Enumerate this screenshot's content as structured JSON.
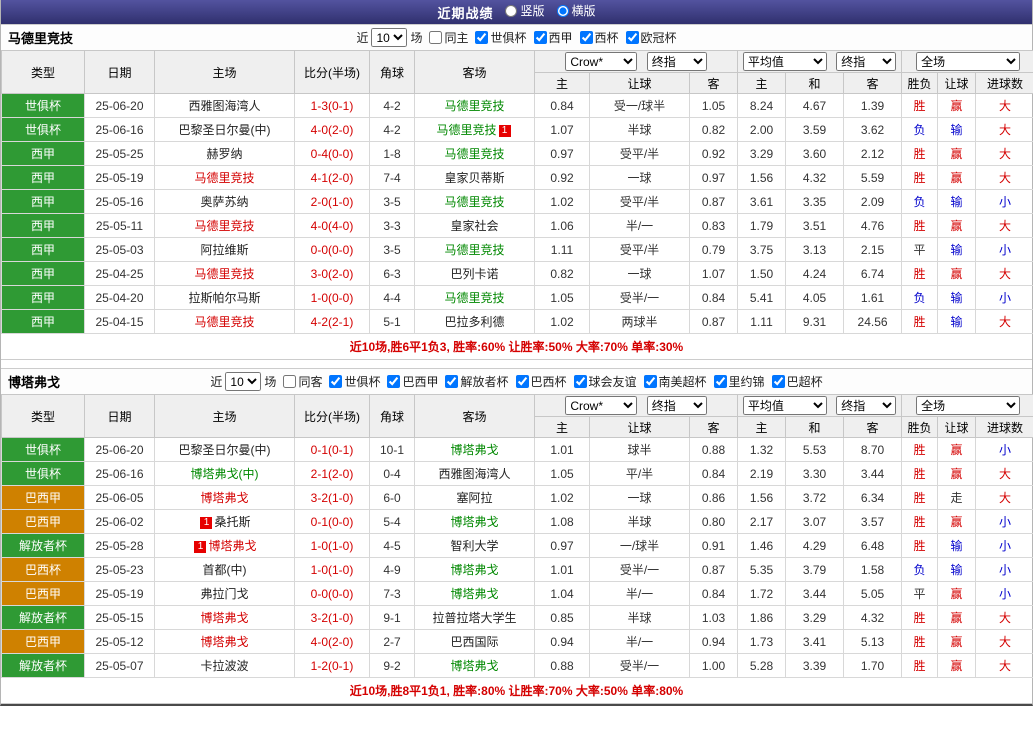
{
  "topbar": {
    "title": "近期战绩",
    "options": [
      {
        "label": "竖版",
        "selected": false
      },
      {
        "label": "横版",
        "selected": true
      }
    ]
  },
  "columns": {
    "type": "类型",
    "date": "日期",
    "home": "主场",
    "score": "比分(半场)",
    "corner": "角球",
    "away": "客场",
    "h_home": "主",
    "h_handicap": "让球",
    "h_away": "客",
    "a_home": "主",
    "a_draw": "和",
    "a_away": "客",
    "result": "胜负",
    "handicap_result": "让球",
    "goals": "进球数"
  },
  "selects": {
    "book": "Crow*",
    "final1": "终指",
    "avg": "平均值",
    "final2": "终指",
    "scope": "全场"
  },
  "tables": [
    {
      "team": "马德里竞技",
      "filter": {
        "near": "近",
        "count": "10",
        "unit": "场",
        "same": "同主",
        "same_checked": false,
        "leagues": [
          {
            "label": "世俱杯",
            "checked": true
          },
          {
            "label": "西甲",
            "checked": true
          },
          {
            "label": "西杯",
            "checked": true
          },
          {
            "label": "欧冠杯",
            "checked": true
          }
        ]
      },
      "rows": [
        {
          "league": "世俱杯",
          "league_cls": "lg-green",
          "date": "25-06-20",
          "home": "西雅图海湾人",
          "home_cls": "black",
          "home_badge": "",
          "score": "1-3(0-1)",
          "corner": "4-2",
          "away": "马德里竞技",
          "away_cls": "green",
          "away_badge": "",
          "odds": [
            "0.84",
            "受一/球半",
            "1.05"
          ],
          "avg": [
            "8.24",
            "4.67",
            "1.39"
          ],
          "res": [
            {
              "t": "胜",
              "c": "red"
            },
            {
              "t": "赢",
              "c": "red"
            },
            {
              "t": "大",
              "c": "red"
            }
          ]
        },
        {
          "league": "世俱杯",
          "league_cls": "lg-green",
          "date": "25-06-16",
          "home": "巴黎圣日尔曼(中)",
          "home_cls": "black",
          "home_badge": "",
          "score": "4-0(2-0)",
          "corner": "4-2",
          "away": "马德里竞技",
          "away_cls": "green",
          "away_badge": "1",
          "odds": [
            "1.07",
            "半球",
            "0.82"
          ],
          "avg": [
            "2.00",
            "3.59",
            "3.62"
          ],
          "res": [
            {
              "t": "负",
              "c": "blue"
            },
            {
              "t": "输",
              "c": "blue"
            },
            {
              "t": "大",
              "c": "red"
            }
          ]
        },
        {
          "league": "西甲",
          "league_cls": "lg-green",
          "date": "25-05-25",
          "home": "赫罗纳",
          "home_cls": "black",
          "home_badge": "",
          "score": "0-4(0-0)",
          "corner": "1-8",
          "away": "马德里竞技",
          "away_cls": "green",
          "away_badge": "",
          "odds": [
            "0.97",
            "受平/半",
            "0.92"
          ],
          "avg": [
            "3.29",
            "3.60",
            "2.12"
          ],
          "res": [
            {
              "t": "胜",
              "c": "red"
            },
            {
              "t": "赢",
              "c": "red"
            },
            {
              "t": "大",
              "c": "red"
            }
          ]
        },
        {
          "league": "西甲",
          "league_cls": "lg-green",
          "date": "25-05-19",
          "home": "马德里竞技",
          "home_cls": "red",
          "home_badge": "",
          "score": "4-1(2-0)",
          "corner": "7-4",
          "away": "皇家贝蒂斯",
          "away_cls": "black",
          "away_badge": "",
          "odds": [
            "0.92",
            "一球",
            "0.97"
          ],
          "avg": [
            "1.56",
            "4.32",
            "5.59"
          ],
          "res": [
            {
              "t": "胜",
              "c": "red"
            },
            {
              "t": "赢",
              "c": "red"
            },
            {
              "t": "大",
              "c": "red"
            }
          ]
        },
        {
          "league": "西甲",
          "league_cls": "lg-green",
          "date": "25-05-16",
          "home": "奥萨苏纳",
          "home_cls": "black",
          "home_badge": "",
          "score": "2-0(1-0)",
          "corner": "3-5",
          "away": "马德里竞技",
          "away_cls": "green",
          "away_badge": "",
          "odds": [
            "1.02",
            "受平/半",
            "0.87"
          ],
          "avg": [
            "3.61",
            "3.35",
            "2.09"
          ],
          "res": [
            {
              "t": "负",
              "c": "blue"
            },
            {
              "t": "输",
              "c": "blue"
            },
            {
              "t": "小",
              "c": "blue"
            }
          ]
        },
        {
          "league": "西甲",
          "league_cls": "lg-green",
          "date": "25-05-11",
          "home": "马德里竞技",
          "home_cls": "red",
          "home_badge": "",
          "score": "4-0(4-0)",
          "corner": "3-3",
          "away": "皇家社会",
          "away_cls": "black",
          "away_badge": "",
          "odds": [
            "1.06",
            "半/一",
            "0.83"
          ],
          "avg": [
            "1.79",
            "3.51",
            "4.76"
          ],
          "res": [
            {
              "t": "胜",
              "c": "red"
            },
            {
              "t": "赢",
              "c": "red"
            },
            {
              "t": "大",
              "c": "red"
            }
          ]
        },
        {
          "league": "西甲",
          "league_cls": "lg-green",
          "date": "25-05-03",
          "home": "阿拉维斯",
          "home_cls": "black",
          "home_badge": "",
          "score": "0-0(0-0)",
          "corner": "3-5",
          "away": "马德里竞技",
          "away_cls": "green",
          "away_badge": "",
          "odds": [
            "1.11",
            "受平/半",
            "0.79"
          ],
          "avg": [
            "3.75",
            "3.13",
            "2.15"
          ],
          "res": [
            {
              "t": "平",
              "c": "black"
            },
            {
              "t": "输",
              "c": "blue"
            },
            {
              "t": "小",
              "c": "blue"
            }
          ]
        },
        {
          "league": "西甲",
          "league_cls": "lg-green",
          "date": "25-04-25",
          "home": "马德里竞技",
          "home_cls": "red",
          "home_badge": "",
          "score": "3-0(2-0)",
          "corner": "6-3",
          "away": "巴列卡诺",
          "away_cls": "black",
          "away_badge": "",
          "odds": [
            "0.82",
            "一球",
            "1.07"
          ],
          "avg": [
            "1.50",
            "4.24",
            "6.74"
          ],
          "res": [
            {
              "t": "胜",
              "c": "red"
            },
            {
              "t": "赢",
              "c": "red"
            },
            {
              "t": "大",
              "c": "red"
            }
          ]
        },
        {
          "league": "西甲",
          "league_cls": "lg-green",
          "date": "25-04-20",
          "home": "拉斯帕尔马斯",
          "home_cls": "black",
          "home_badge": "",
          "score": "1-0(0-0)",
          "corner": "4-4",
          "away": "马德里竞技",
          "away_cls": "green",
          "away_badge": "",
          "odds": [
            "1.05",
            "受半/一",
            "0.84"
          ],
          "avg": [
            "5.41",
            "4.05",
            "1.61"
          ],
          "res": [
            {
              "t": "负",
              "c": "blue"
            },
            {
              "t": "输",
              "c": "blue"
            },
            {
              "t": "小",
              "c": "blue"
            }
          ]
        },
        {
          "league": "西甲",
          "league_cls": "lg-green",
          "date": "25-04-15",
          "home": "马德里竞技",
          "home_cls": "red",
          "home_badge": "",
          "score": "4-2(2-1)",
          "corner": "5-1",
          "away": "巴拉多利德",
          "away_cls": "black",
          "away_badge": "",
          "odds": [
            "1.02",
            "两球半",
            "0.87"
          ],
          "avg": [
            "1.11",
            "9.31",
            "24.56"
          ],
          "res": [
            {
              "t": "胜",
              "c": "red"
            },
            {
              "t": "输",
              "c": "blue"
            },
            {
              "t": "大",
              "c": "red"
            }
          ]
        }
      ],
      "summary": "近10场,胜6平1负3, 胜率:60% 让胜率:50% 大率:70% 单率:30%"
    },
    {
      "team": "博塔弗戈",
      "filter": {
        "near": "近",
        "count": "10",
        "unit": "场",
        "same": "同客",
        "same_checked": false,
        "leagues": [
          {
            "label": "世俱杯",
            "checked": true
          },
          {
            "label": "巴西甲",
            "checked": true
          },
          {
            "label": "解放者杯",
            "checked": true
          },
          {
            "label": "巴西杯",
            "checked": true
          },
          {
            "label": "球会友谊",
            "checked": true
          },
          {
            "label": "南美超杯",
            "checked": true
          },
          {
            "label": "里约锦",
            "checked": true
          },
          {
            "label": "巴超杯",
            "checked": true
          }
        ]
      },
      "rows": [
        {
          "league": "世俱杯",
          "league_cls": "lg-green",
          "date": "25-06-20",
          "home": "巴黎圣日尔曼(中)",
          "home_cls": "black",
          "home_badge": "",
          "score": "0-1(0-1)",
          "corner": "10-1",
          "away": "博塔弗戈",
          "away_cls": "green",
          "away_badge": "",
          "odds": [
            "1.01",
            "球半",
            "0.88"
          ],
          "avg": [
            "1.32",
            "5.53",
            "8.70"
          ],
          "res": [
            {
              "t": "胜",
              "c": "red"
            },
            {
              "t": "赢",
              "c": "red"
            },
            {
              "t": "小",
              "c": "blue"
            }
          ]
        },
        {
          "league": "世俱杯",
          "league_cls": "lg-green",
          "date": "25-06-16",
          "home": "博塔弗戈(中)",
          "home_cls": "green",
          "home_badge": "",
          "score": "2-1(2-0)",
          "corner": "0-4",
          "away": "西雅图海湾人",
          "away_cls": "black",
          "away_badge": "",
          "odds": [
            "1.05",
            "平/半",
            "0.84"
          ],
          "avg": [
            "2.19",
            "3.30",
            "3.44"
          ],
          "res": [
            {
              "t": "胜",
              "c": "red"
            },
            {
              "t": "赢",
              "c": "red"
            },
            {
              "t": "大",
              "c": "red"
            }
          ]
        },
        {
          "league": "巴西甲",
          "league_cls": "lg-orange",
          "date": "25-06-05",
          "home": "博塔弗戈",
          "home_cls": "red",
          "home_badge": "",
          "score": "3-2(1-0)",
          "corner": "6-0",
          "away": "塞阿拉",
          "away_cls": "black",
          "away_badge": "",
          "odds": [
            "1.02",
            "一球",
            "0.86"
          ],
          "avg": [
            "1.56",
            "3.72",
            "6.34"
          ],
          "res": [
            {
              "t": "胜",
              "c": "red"
            },
            {
              "t": "走",
              "c": "black"
            },
            {
              "t": "大",
              "c": "red"
            }
          ]
        },
        {
          "league": "巴西甲",
          "league_cls": "lg-orange",
          "date": "25-06-02",
          "home": "桑托斯",
          "home_cls": "black",
          "home_badge": "1",
          "score": "0-1(0-0)",
          "corner": "5-4",
          "away": "博塔弗戈",
          "away_cls": "green",
          "away_badge": "",
          "odds": [
            "1.08",
            "半球",
            "0.80"
          ],
          "avg": [
            "2.17",
            "3.07",
            "3.57"
          ],
          "res": [
            {
              "t": "胜",
              "c": "red"
            },
            {
              "t": "赢",
              "c": "red"
            },
            {
              "t": "小",
              "c": "blue"
            }
          ]
        },
        {
          "league": "解放者杯",
          "league_cls": "lg-green",
          "date": "25-05-28",
          "home": "博塔弗戈",
          "home_cls": "red",
          "home_badge": "1",
          "score": "1-0(1-0)",
          "corner": "4-5",
          "away": "智利大学",
          "away_cls": "black",
          "away_badge": "",
          "odds": [
            "0.97",
            "一/球半",
            "0.91"
          ],
          "avg": [
            "1.46",
            "4.29",
            "6.48"
          ],
          "res": [
            {
              "t": "胜",
              "c": "red"
            },
            {
              "t": "输",
              "c": "blue"
            },
            {
              "t": "小",
              "c": "blue"
            }
          ]
        },
        {
          "league": "巴西杯",
          "league_cls": "lg-orange",
          "date": "25-05-23",
          "home": "首都(中)",
          "home_cls": "black",
          "home_badge": "",
          "score": "1-0(1-0)",
          "corner": "4-9",
          "away": "博塔弗戈",
          "away_cls": "green",
          "away_badge": "",
          "odds": [
            "1.01",
            "受半/一",
            "0.87"
          ],
          "avg": [
            "5.35",
            "3.79",
            "1.58"
          ],
          "res": [
            {
              "t": "负",
              "c": "blue"
            },
            {
              "t": "输",
              "c": "blue"
            },
            {
              "t": "小",
              "c": "blue"
            }
          ]
        },
        {
          "league": "巴西甲",
          "league_cls": "lg-orange",
          "date": "25-05-19",
          "home": "弗拉门戈",
          "home_cls": "black",
          "home_badge": "",
          "score": "0-0(0-0)",
          "corner": "7-3",
          "away": "博塔弗戈",
          "away_cls": "green",
          "away_badge": "",
          "odds": [
            "1.04",
            "半/一",
            "0.84"
          ],
          "avg": [
            "1.72",
            "3.44",
            "5.05"
          ],
          "res": [
            {
              "t": "平",
              "c": "black"
            },
            {
              "t": "赢",
              "c": "red"
            },
            {
              "t": "小",
              "c": "blue"
            }
          ]
        },
        {
          "league": "解放者杯",
          "league_cls": "lg-green",
          "date": "25-05-15",
          "home": "博塔弗戈",
          "home_cls": "red",
          "home_badge": "",
          "score": "3-2(1-0)",
          "corner": "9-1",
          "away": "拉普拉塔大学生",
          "away_cls": "black",
          "away_badge": "",
          "odds": [
            "0.85",
            "半球",
            "1.03"
          ],
          "avg": [
            "1.86",
            "3.29",
            "4.32"
          ],
          "res": [
            {
              "t": "胜",
              "c": "red"
            },
            {
              "t": "赢",
              "c": "red"
            },
            {
              "t": "大",
              "c": "red"
            }
          ]
        },
        {
          "league": "巴西甲",
          "league_cls": "lg-orange",
          "date": "25-05-12",
          "home": "博塔弗戈",
          "home_cls": "red",
          "home_badge": "",
          "score": "4-0(2-0)",
          "corner": "2-7",
          "away": "巴西国际",
          "away_cls": "black",
          "away_badge": "",
          "odds": [
            "0.94",
            "半/一",
            "0.94"
          ],
          "avg": [
            "1.73",
            "3.41",
            "5.13"
          ],
          "res": [
            {
              "t": "胜",
              "c": "red"
            },
            {
              "t": "赢",
              "c": "red"
            },
            {
              "t": "大",
              "c": "red"
            }
          ]
        },
        {
          "league": "解放者杯",
          "league_cls": "lg-green",
          "date": "25-05-07",
          "home": "卡拉波波",
          "home_cls": "black",
          "home_badge": "",
          "score": "1-2(0-1)",
          "corner": "9-2",
          "away": "博塔弗戈",
          "away_cls": "green",
          "away_badge": "",
          "odds": [
            "0.88",
            "受半/一",
            "1.00"
          ],
          "avg": [
            "5.28",
            "3.39",
            "1.70"
          ],
          "res": [
            {
              "t": "胜",
              "c": "red"
            },
            {
              "t": "赢",
              "c": "red"
            },
            {
              "t": "大",
              "c": "red"
            }
          ]
        }
      ],
      "summary": "近10场,胜8平1负1, 胜率:80% 让胜率:70% 大率:50% 单率:80%"
    }
  ]
}
